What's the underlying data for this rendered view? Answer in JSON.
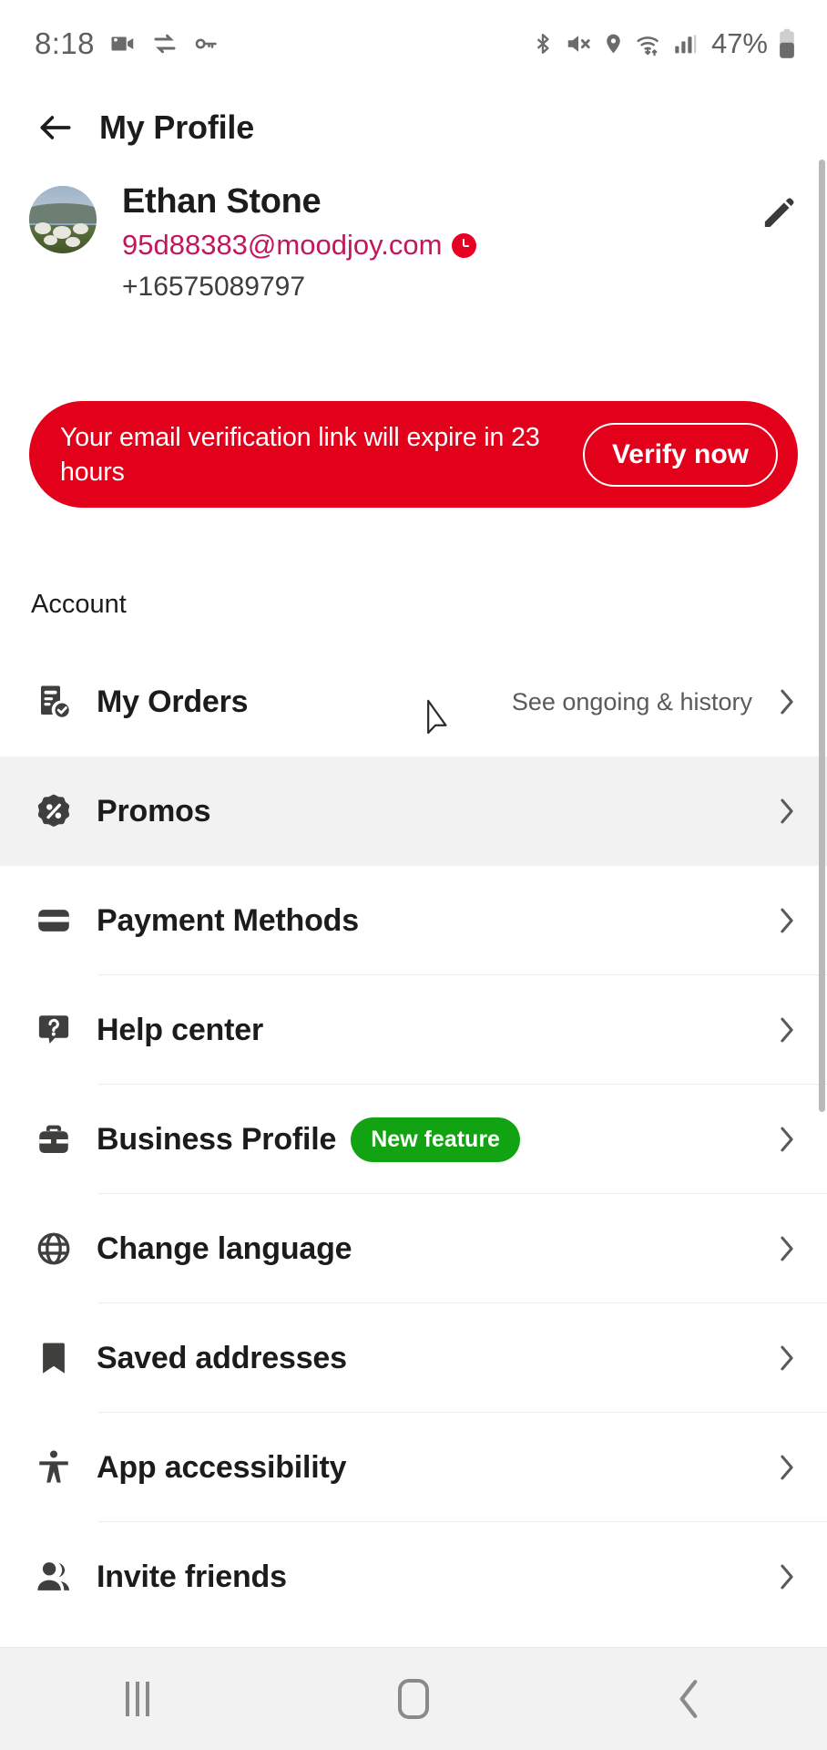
{
  "status_bar": {
    "time": "8:18",
    "left_icons": [
      "video-camera-icon",
      "data-transfer-icon",
      "key-icon"
    ],
    "right_icons": [
      "bluetooth-icon",
      "mute-icon",
      "location-icon",
      "wifi-icon",
      "cellular-signal-icon"
    ],
    "battery_percent": "47%"
  },
  "app_bar": {
    "back_icon": "arrow-left-icon",
    "title": "My Profile"
  },
  "profile": {
    "avatar_alt": "sheep-photo-avatar",
    "name": "Ethan Stone",
    "email": "95d88383@moodjoy.com",
    "email_status_icon": "clock-warning-icon",
    "phone": "+16575089797",
    "edit_icon": "pencil-edit-icon",
    "email_color": "#c2185b"
  },
  "banner": {
    "message": "Your email verification link will expire in 23 hours",
    "action_label": "Verify now",
    "background_color": "#e2001a",
    "text_color": "#ffffff"
  },
  "account": {
    "section_title": "Account",
    "items": [
      {
        "label": "My Orders",
        "icon": "orders-receipt-check-icon",
        "subtitle": "See ongoing & history",
        "badge": null,
        "chevron": "chevron-right-icon",
        "highlighted": false,
        "divider": false
      },
      {
        "label": "Promos",
        "icon": "promo-percent-badge-icon",
        "subtitle": null,
        "badge": null,
        "chevron": "chevron-right-icon",
        "highlighted": true,
        "divider": false
      },
      {
        "label": "Payment Methods",
        "icon": "credit-card-icon",
        "subtitle": null,
        "badge": null,
        "chevron": "chevron-right-icon",
        "highlighted": false,
        "divider": true
      },
      {
        "label": "Help center",
        "icon": "help-question-bubble-icon",
        "subtitle": null,
        "badge": null,
        "chevron": "chevron-right-icon",
        "highlighted": false,
        "divider": true
      },
      {
        "label": "Business Profile",
        "icon": "briefcase-icon",
        "subtitle": null,
        "badge": "New feature",
        "badge_color": "#12a312",
        "chevron": "chevron-right-icon",
        "highlighted": false,
        "divider": true
      },
      {
        "label": "Change language",
        "icon": "globe-icon",
        "subtitle": null,
        "badge": null,
        "chevron": "chevron-right-icon",
        "highlighted": false,
        "divider": true
      },
      {
        "label": "Saved addresses",
        "icon": "bookmark-icon",
        "subtitle": null,
        "badge": null,
        "chevron": "chevron-right-icon",
        "highlighted": false,
        "divider": true
      },
      {
        "label": "App accessibility",
        "icon": "accessibility-person-icon",
        "subtitle": null,
        "badge": null,
        "chevron": "chevron-right-icon",
        "highlighted": false,
        "divider": true
      },
      {
        "label": "Invite friends",
        "icon": "people-group-icon",
        "subtitle": null,
        "badge": null,
        "chevron": "chevron-right-icon",
        "highlighted": false,
        "divider": false
      }
    ]
  },
  "navigation_bar": {
    "recents_icon": "recents-bars-icon",
    "home_icon": "home-square-icon",
    "back_icon": "nav-back-chevron-icon"
  }
}
